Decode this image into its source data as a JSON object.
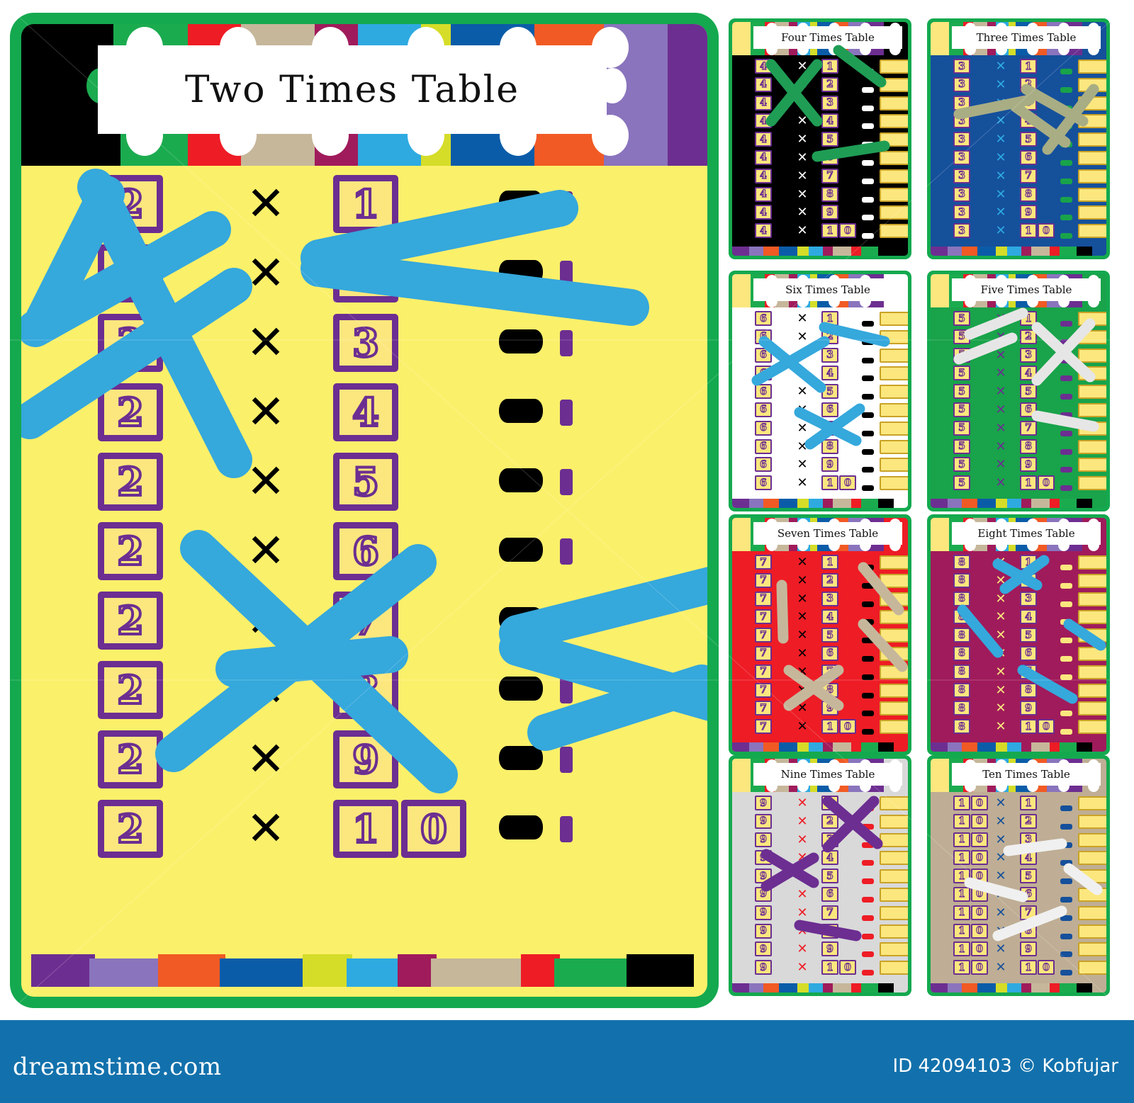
{
  "footer": {
    "site": "dreamstime.com",
    "id_text": "ID 42094103 © Kobfujar"
  },
  "colors": {
    "poster_border_green": "#14a94f",
    "poster_bg_yellow": "#fbf06a",
    "card_fill_yellow": "#fbe77e",
    "crayon_purple": "#6c2e91",
    "crayon_blue": "#35a8dc",
    "footer_blue": "#1271ac"
  },
  "main_poster": {
    "title": "Two Times Table",
    "multiplicand": "2",
    "x_symbol": "✕",
    "equals_symbol": "=",
    "multipliers": [
      "1",
      "2",
      "3",
      "4",
      "5",
      "6",
      "7",
      "8",
      "9",
      "10"
    ],
    "answers": [
      "",
      "",
      "",
      "",
      "",
      "",
      "",
      "",
      "",
      ""
    ],
    "header_strip_colors": [
      "#000000",
      "#1bab4f",
      "#ee1c25",
      "#c6b79b",
      "#a01b5b",
      "#2eaae1",
      "#d5dd28",
      "#0b5ca8",
      "#f15a24",
      "#8a74bd",
      "#6d2e91"
    ],
    "footer_strip_colors": [
      "#6d2e91",
      "#8a74bd",
      "#f15a24",
      "#0b5ca8",
      "#d5dd28",
      "#2eaae1",
      "#a01b5b",
      "#c6b79b",
      "#ee1c25",
      "#1bab4f",
      "#000000"
    ],
    "scribble_color": "#35a8dc"
  },
  "thumbnails": [
    {
      "title": "Four Times Table",
      "multiplicand": "4",
      "bg": "#000000",
      "symbol_color": "#ffffff",
      "equals_color": "#ffffff",
      "scribble_color": "#1f9d55",
      "multipliers": [
        "1",
        "2",
        "3",
        "4",
        "5",
        "6",
        "7",
        "8",
        "9",
        "10"
      ]
    },
    {
      "title": "Three Times Table",
      "multiplicand": "3",
      "bg": "#15509b",
      "symbol_color": "#2eaae1",
      "equals_color": "#19a34a",
      "scribble_color": "#a8ad84",
      "multipliers": [
        "1",
        "2",
        "3",
        "4",
        "5",
        "6",
        "7",
        "8",
        "9",
        "10"
      ]
    },
    {
      "title": "Six Times Table",
      "multiplicand": "6",
      "bg": "#ffffff",
      "symbol_color": "#000000",
      "equals_color": "#000000",
      "scribble_color": "#35a8dc",
      "multipliers": [
        "1",
        "2",
        "3",
        "4",
        "5",
        "6",
        "7",
        "8",
        "9",
        "10"
      ]
    },
    {
      "title": "Five Times Table",
      "multiplicand": "5",
      "bg": "#19a34a",
      "symbol_color": "#6c2e91",
      "equals_color": "#6c2e91",
      "scribble_color": "#e6e6e6",
      "multipliers": [
        "1",
        "2",
        "3",
        "4",
        "5",
        "6",
        "7",
        "8",
        "9",
        "10"
      ]
    },
    {
      "title": "Seven Times Table",
      "multiplicand": "7",
      "bg": "#ee1c25",
      "symbol_color": "#000000",
      "equals_color": "#000000",
      "scribble_color": "#c6b79b",
      "multipliers": [
        "1",
        "2",
        "3",
        "4",
        "5",
        "6",
        "7",
        "8",
        "9",
        "10"
      ]
    },
    {
      "title": "Eight Times Table",
      "multiplicand": "8",
      "bg": "#a01b5b",
      "symbol_color": "#fbe77e",
      "equals_color": "#fbe77e",
      "scribble_color": "#35a8dc",
      "multipliers": [
        "1",
        "2",
        "3",
        "4",
        "5",
        "6",
        "7",
        "8",
        "9",
        "10"
      ]
    },
    {
      "title": "Nine Times Table",
      "multiplicand": "9",
      "bg": "#d9d9d9",
      "symbol_color": "#ee1c25",
      "equals_color": "#ee1c25",
      "scribble_color": "#6c2e91",
      "multipliers": [
        "1",
        "2",
        "3",
        "4",
        "5",
        "6",
        "7",
        "8",
        "9",
        "10"
      ]
    },
    {
      "title": "Ten Times Table",
      "multiplicand": "10",
      "bg": "#bfae95",
      "symbol_color": "#15509b",
      "equals_color": "#15509b",
      "scribble_color": "#f0f0f0",
      "multipliers": [
        "1",
        "2",
        "3",
        "4",
        "5",
        "6",
        "7",
        "8",
        "9",
        "10"
      ]
    }
  ]
}
